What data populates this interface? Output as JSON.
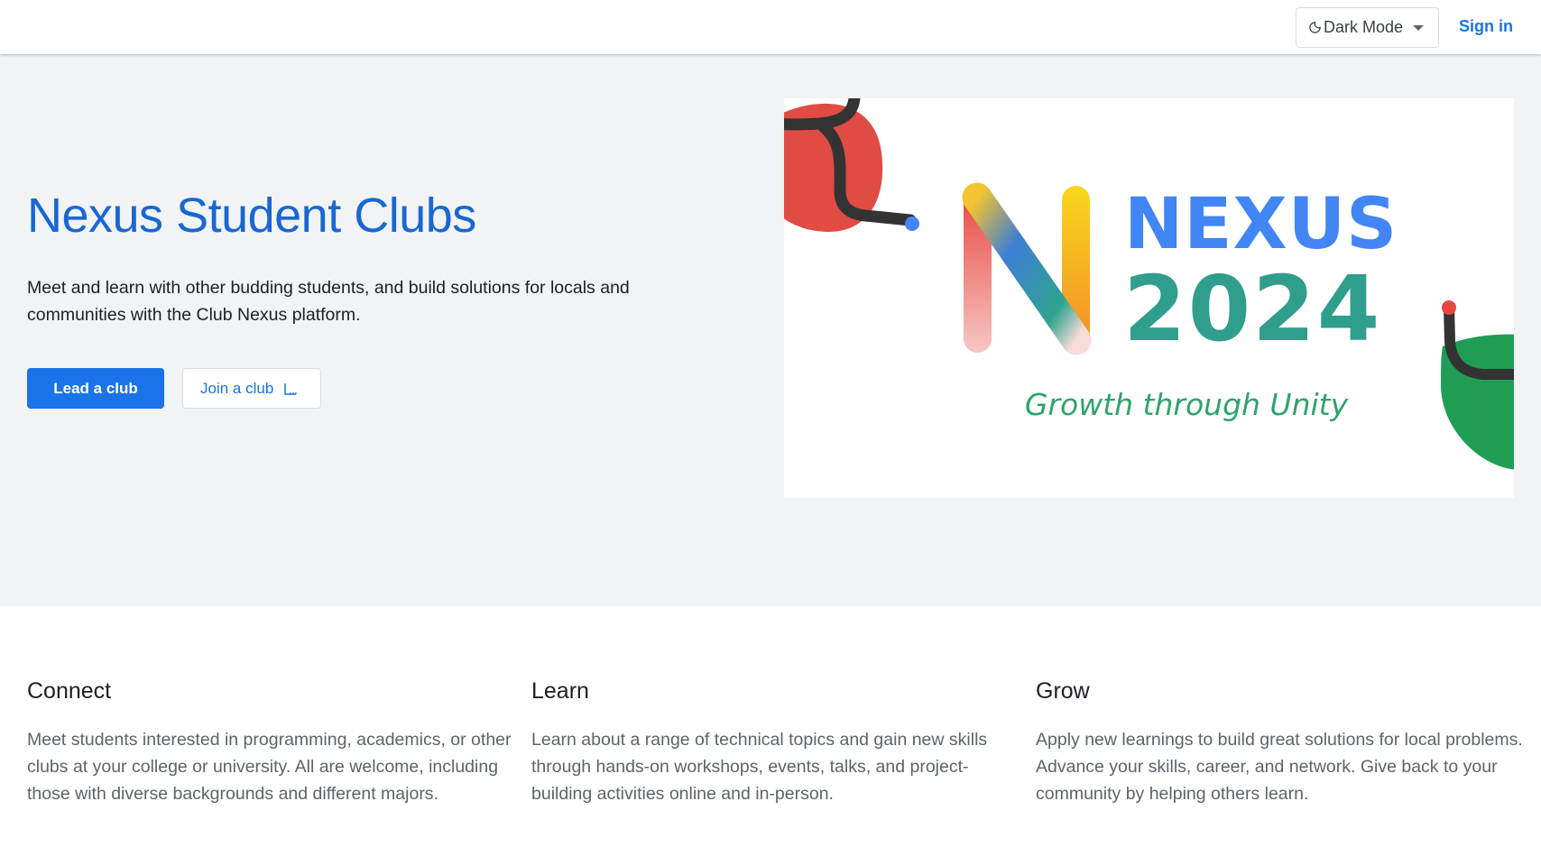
{
  "header": {
    "theme_label": "Dark Mode",
    "sign_in": "Sign in"
  },
  "hero": {
    "title": "Nexus Student Clubs",
    "description": "Meet and learn with other budding students, and build solutions for locals and communities with the Club Nexus platform.",
    "lead_button": "Lead a club",
    "join_button": "Join a club"
  },
  "banner": {
    "word": "NEXUS",
    "year": "2024",
    "tagline": "Growth through Unity"
  },
  "features": [
    {
      "title": "Connect",
      "text": "Meet students interested in programming, academics, or other clubs at your college or university. All are welcome, including those with diverse backgrounds and different majors."
    },
    {
      "title": "Learn",
      "text": "Learn about a range of technical topics and gain new skills through hands-on workshops, events, talks, and project-building activities online and in-person."
    },
    {
      "title": "Grow",
      "text": "Apply new learnings to build great solutions for local problems. Advance your skills, career, and network. Give back to your community by helping others learn."
    }
  ],
  "colors": {
    "brand_blue": "#1a73e8",
    "hero_bg": "#f1f3f4",
    "title_blue": "#1967d2"
  }
}
